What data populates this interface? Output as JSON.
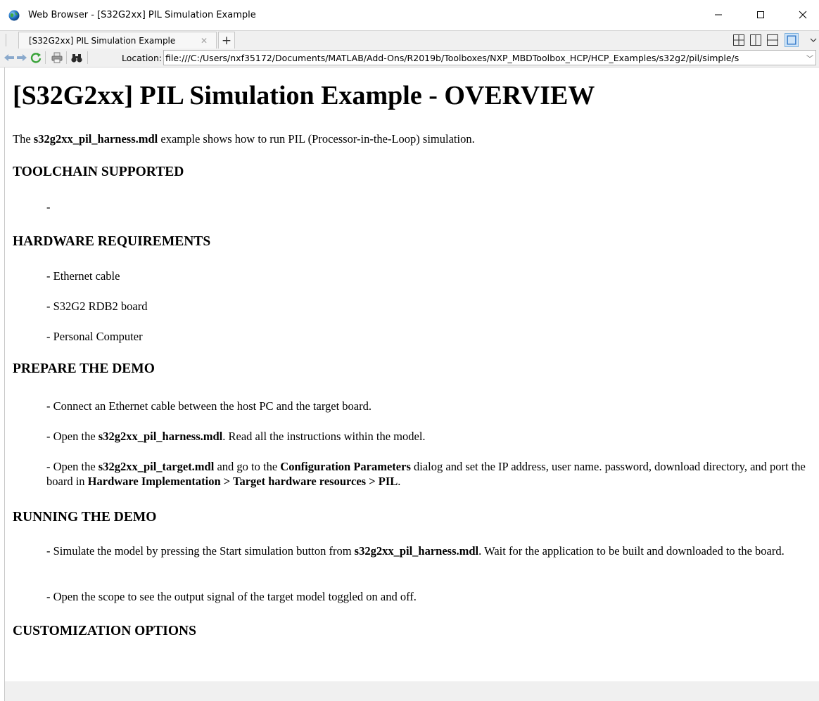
{
  "window": {
    "title": "Web Browser - [S32G2xx] PIL Simulation Example",
    "minimize_glyph": "─",
    "maximize_glyph": "☐",
    "close_glyph": "✕"
  },
  "tabs": [
    {
      "label": "[S32G2xx] PIL Simulation Example",
      "close_glyph": "✕"
    }
  ],
  "new_tab_glyph": "+",
  "toolbar": {
    "location_label": "Location:",
    "url": "file:///C:/Users/nxf35172/Documents/MATLAB/Add-Ons/R2019b/Toolboxes/NXP_MBDToolbox_HCP/HCP_Examples/s32g2/pil/simple/s",
    "dropdown_glyph": "﹀"
  },
  "colors": {
    "nav_arrow": "#5d8ec6",
    "refresh": "#3aa33a",
    "active_layout": "#2d74c7"
  },
  "page": {
    "title": "[S32G2xx] PIL Simulation Example - OVERVIEW",
    "intro": {
      "pre": "The ",
      "model": "s32g2xx_pil_harness.mdl",
      "post": " example shows how to run PIL (Processor-in-the-Loop) simulation."
    },
    "toolchain": {
      "heading": "TOOLCHAIN SUPPORTED",
      "item": "-"
    },
    "hardware": {
      "heading": "HARDWARE REQUIREMENTS",
      "items": [
        "- Ethernet cable",
        "- S32G2 RDB2 board",
        "- Personal Computer"
      ]
    },
    "prepare": {
      "heading": "PREPARE THE DEMO",
      "step1": "- Connect an Ethernet cable between the host PC and the target board.",
      "step2_pre": "- Open the ",
      "step2_model": "s32g2xx_pil_harness.mdl",
      "step2_post": ". Read all the instructions within the model.",
      "step3_pre": "- Open the ",
      "step3_model": "s32g2xx_pil_target.mdl",
      "step3_mid": " and go to the ",
      "step3_dialog": "Configuration Parameters",
      "step3_mid2": " dialog and set the IP address, user name. password, download directory, and port the board in ",
      "step3_path": "Hardware Implementation > Target hardware resources > PIL",
      "step3_end": "."
    },
    "running": {
      "heading": "RUNNING THE DEMO",
      "step1_pre": "- Simulate the model by pressing the Start simulation button from ",
      "step1_model": "s32g2xx_pil_harness.mdl",
      "step1_post": ". Wait for the application to be built and downloaded to the board.",
      "step2": "- Open the scope to see the output signal of the target model toggled on and off."
    },
    "customization": {
      "heading": "CUSTOMIZATION OPTIONS"
    }
  }
}
